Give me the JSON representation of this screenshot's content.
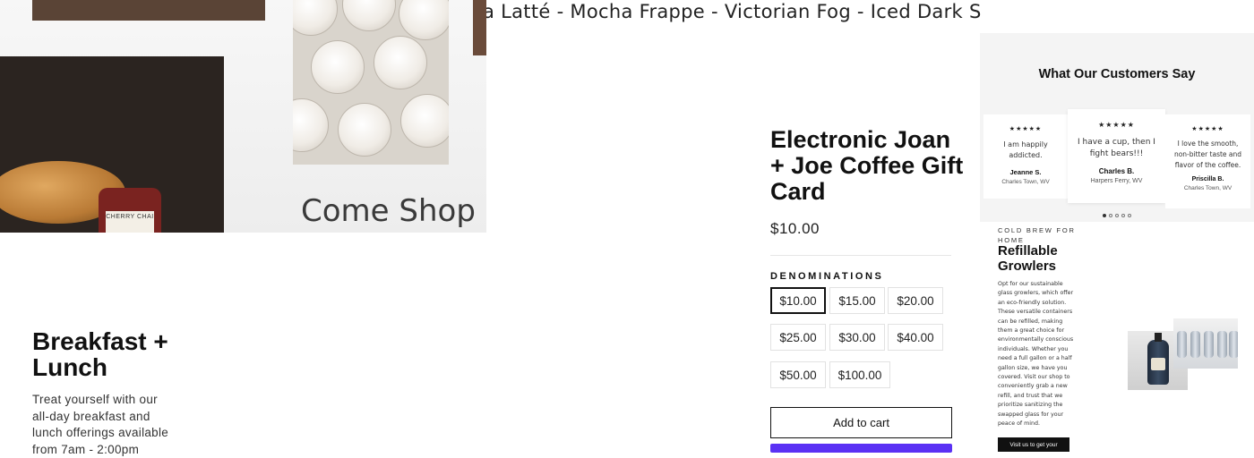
{
  "hero": {
    "sign_text": "Come Shop",
    "jar_label": "CHERRY CHAI"
  },
  "marquee": {
    "text": "a Latté - Mocha Frappe - Victorian Fog - Iced Dark Salted Caram"
  },
  "breakfast": {
    "title": "Breakfast + Lunch",
    "text": "Treat yourself with our all-day breakfast and lunch offerings available from 7am - 2:00pm"
  },
  "product": {
    "title": "Electronic Joan + Joe Coffee Gift Card",
    "price": "$10.00",
    "denominations_label": "DENOMINATIONS",
    "denominations": [
      "$10.00",
      "$15.00",
      "$20.00",
      "$25.00",
      "$30.00",
      "$40.00",
      "$50.00",
      "$100.00"
    ],
    "selected": "$10.00",
    "add_to_cart": "Add to cart"
  },
  "testimonials": {
    "title": "What Our Customers Say",
    "stars": "★★★★★",
    "items": [
      {
        "quote": "I am happily addicted.",
        "name": "Jeanne S.",
        "location": "Charles Town, WV"
      },
      {
        "quote": "I have a cup, then I fight bears!!!",
        "name": "Charles B.",
        "location": "Harpers Ferry, WV"
      },
      {
        "quote": "I love the smooth, non-bitter taste and flavor of the coffee.",
        "name": "Priscilla B.",
        "location": "Charles Town, WV"
      }
    ],
    "active_index": 0,
    "page_count": 5
  },
  "growlers": {
    "eyebrow": "COLD BREW FOR HOME",
    "title": "Refillable Growlers",
    "text": "Opt for our sustainable glass growlers, which offer an eco-friendly solution. These versatile containers can be refilled, making them a great choice for environmentally conscious individuals. Whether you need a full gallon or a half gallon size, we have you covered. Visit our shop to conveniently grab a new refill, and trust that we prioritize sanitizing the swapped glass for your peace of mind.",
    "button_label": "Visit us to get your"
  },
  "colors": {
    "accent": "#111111",
    "pay_button": "#5a31f4",
    "panel_bg": "#f4f4f4"
  }
}
